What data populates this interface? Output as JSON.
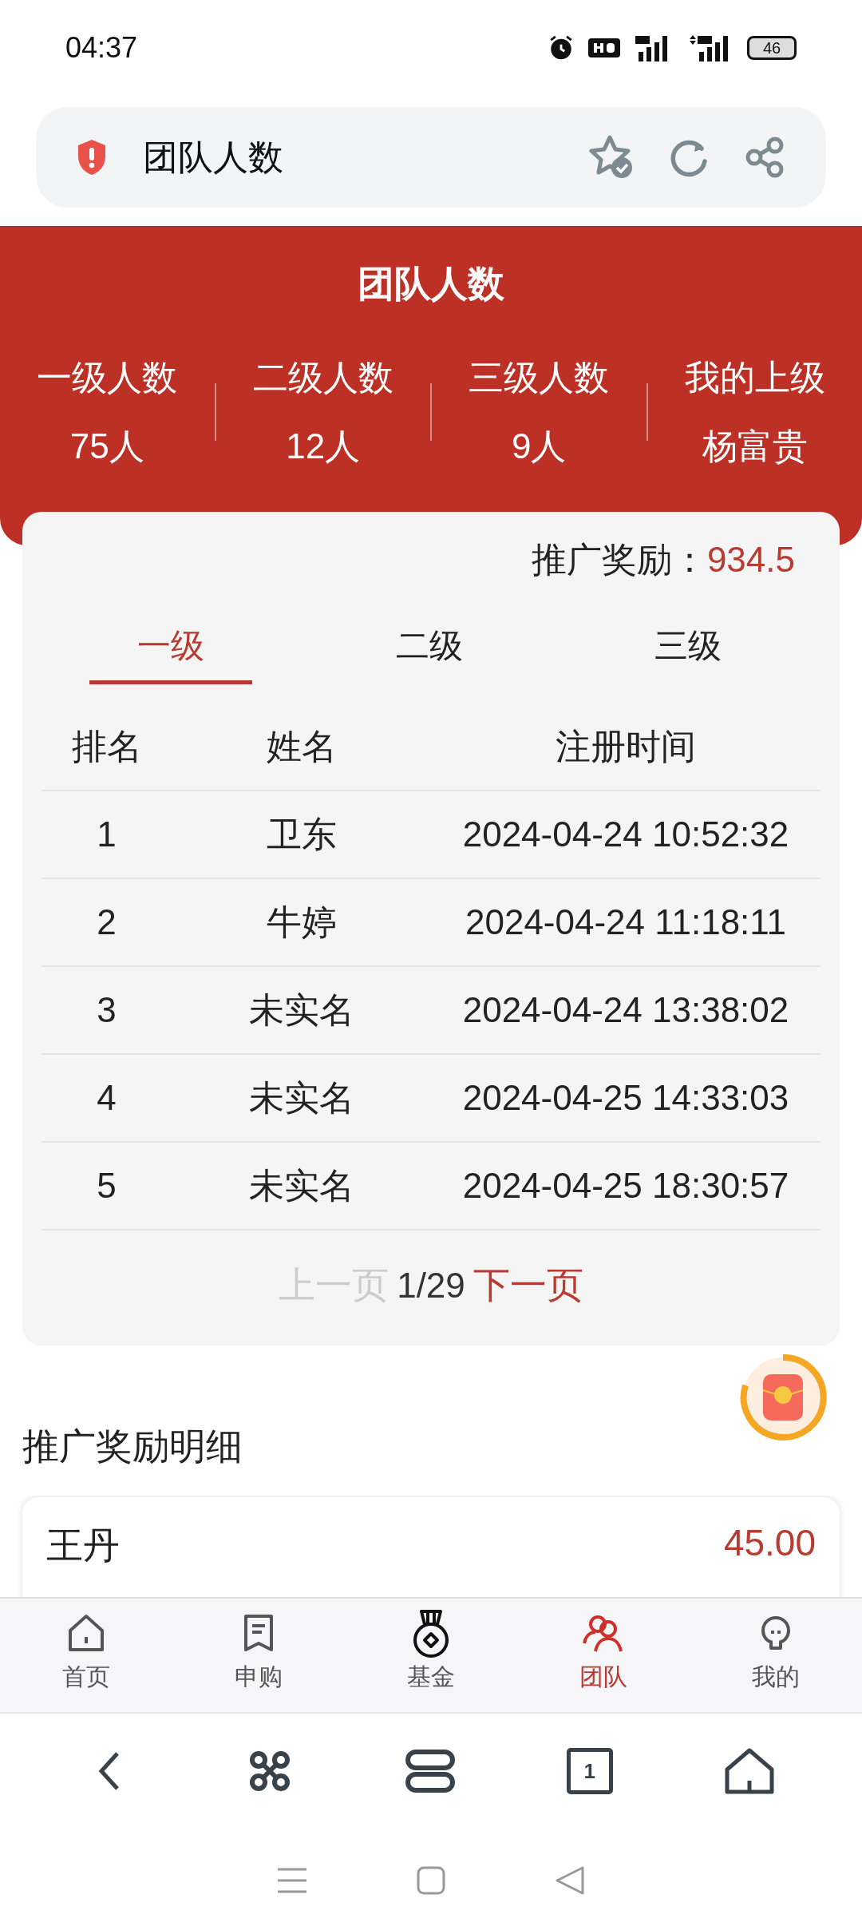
{
  "status_bar": {
    "time": "04:37",
    "battery": "46"
  },
  "address_bar": {
    "title": "团队人数"
  },
  "header": {
    "title": "团队人数",
    "stats": [
      {
        "label": "一级人数",
        "value": "75人"
      },
      {
        "label": "二级人数",
        "value": "12人"
      },
      {
        "label": "三级人数",
        "value": "9人"
      },
      {
        "label": "我的上级",
        "value": "杨富贵"
      }
    ]
  },
  "team_card": {
    "reward_label": "推广奖励：",
    "reward_value": "934.5",
    "tabs": [
      {
        "label": "一级",
        "selected": true
      },
      {
        "label": "二级",
        "selected": false
      },
      {
        "label": "三级",
        "selected": false
      }
    ],
    "table": {
      "columns": [
        "排名",
        "姓名",
        "注册时间"
      ],
      "rows": [
        [
          "1",
          "卫东",
          "2024-04-24 10:52:32"
        ],
        [
          "2",
          "牛婷",
          "2024-04-24 11:18:11"
        ],
        [
          "3",
          "未实名",
          "2024-04-24 13:38:02"
        ],
        [
          "4",
          "未实名",
          "2024-04-25 14:33:03"
        ],
        [
          "5",
          "未实名",
          "2024-04-25 18:30:57"
        ]
      ]
    },
    "pagination": {
      "prev": {
        "label": "上一页",
        "disabled": true
      },
      "page": "1/29",
      "next": {
        "label": "下一页",
        "disabled": false
      }
    }
  },
  "reward_details": {
    "title": "推广奖励明细",
    "items": [
      {
        "name": "王丹",
        "amount": "45.00"
      }
    ]
  },
  "bottom_nav": [
    {
      "label": "首页",
      "selected": false
    },
    {
      "label": "申购",
      "selected": false
    },
    {
      "label": "基金",
      "selected": false
    },
    {
      "label": "团队",
      "selected": true
    },
    {
      "label": "我的",
      "selected": false
    }
  ],
  "browser_toolbar": {
    "tab_count": "1"
  }
}
